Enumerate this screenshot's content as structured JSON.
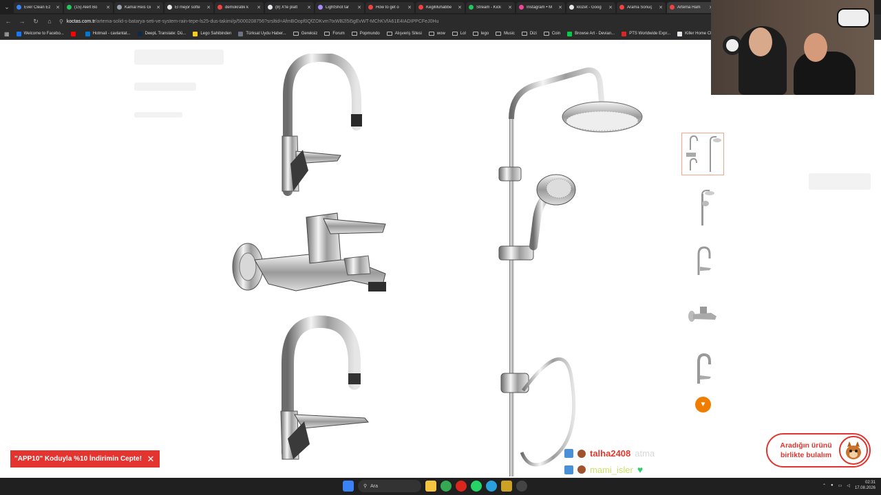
{
  "browser": {
    "tabs": [
      {
        "label": "Ever Clean Ez",
        "color": "#3b82f6"
      },
      {
        "label": "(15) Alert Bo",
        "color": "#22c55e"
      },
      {
        "label": "Kamal Reis Gi",
        "color": "#9ca3af"
      },
      {
        "label": "El mejor softe",
        "color": "#e5e7eb"
      },
      {
        "label": "demokratik k",
        "color": "#ef4444"
      },
      {
        "label": "(8) X'te platt",
        "color": "#e5e7eb"
      },
      {
        "label": "LightShot tar",
        "color": "#a78bfa"
      },
      {
        "label": "How to get o",
        "color": "#ef4444"
      },
      {
        "label": "KegiMuhabbe",
        "color": "#ef4444"
      },
      {
        "label": "Stream - Kick",
        "color": "#22c55e"
      },
      {
        "label": "Instagram • M",
        "color": "#ec4899"
      },
      {
        "label": "klozet - Goog",
        "color": "#e5e7eb"
      },
      {
        "label": "Arama Sonuç",
        "color": "#ef4444"
      },
      {
        "label": "Artema Ham",
        "color": "#ef4444"
      }
    ],
    "url_domain": "koctas.com.tr",
    "url_path": "/artema-solid-s-batarya-seti-ve-system-rain-tepe-ls25-dus-takimi/p/5000208756?srsltid=AfmBOopf0QfZOKvm7txWB2l5i5gEvWT-MChKVfA61E4IADIPPCFeJ0Hu",
    "bookmarks": [
      {
        "label": "Welcome to Facebo...",
        "type": "site",
        "color": "#1877f2"
      },
      {
        "label": "",
        "type": "site",
        "color": "#ff0000"
      },
      {
        "label": "Hotmail - cavlantat...",
        "type": "site",
        "color": "#0078d4"
      },
      {
        "label": "DeepL Translate: Dü...",
        "type": "site",
        "color": "#0f2b46"
      },
      {
        "label": "Lego Sahibinden",
        "type": "site",
        "color": "#facc15"
      },
      {
        "label": "Türksat Uydu Haber...",
        "type": "site",
        "color": "#6b7280"
      },
      {
        "label": "Gereksiz",
        "type": "folder"
      },
      {
        "label": "Forum",
        "type": "folder"
      },
      {
        "label": "Popmundo",
        "type": "folder"
      },
      {
        "label": "Alışveriş Sitesi",
        "type": "folder"
      },
      {
        "label": "wow",
        "type": "folder"
      },
      {
        "label": "Lol",
        "type": "folder"
      },
      {
        "label": "lego",
        "type": "folder"
      },
      {
        "label": "Music",
        "type": "folder"
      },
      {
        "label": "Dizi",
        "type": "folder"
      },
      {
        "label": "Coin",
        "type": "folder"
      },
      {
        "label": "Browse Art - Devian...",
        "type": "site",
        "color": "#05cc47"
      },
      {
        "label": "PTS Worldwide Expr...",
        "type": "site",
        "color": "#dc2626"
      },
      {
        "label": "Killer Home Chest...",
        "type": "site",
        "color": "#e5e7eb"
      }
    ]
  },
  "product": {
    "thumbnails": [
      "set",
      "shower",
      "kitchen-faucet",
      "bath-mixer",
      "basin-faucet"
    ],
    "selected_thumbnail": 0
  },
  "promo": {
    "text": "\"APP10\" Koduyla %10 İndirimin Cepte!"
  },
  "chatbot": {
    "line1": "Aradığın ürünü",
    "line2": "birlikte bulalım"
  },
  "chat": [
    {
      "user": "talha2408",
      "message": "atma",
      "style": "red"
    },
    {
      "user": "mami_isler",
      "message": "",
      "style": "green",
      "heart": true
    }
  ],
  "taskbar": {
    "search_placeholder": "Ara",
    "time": "02:31",
    "date": "17.08.2026"
  }
}
